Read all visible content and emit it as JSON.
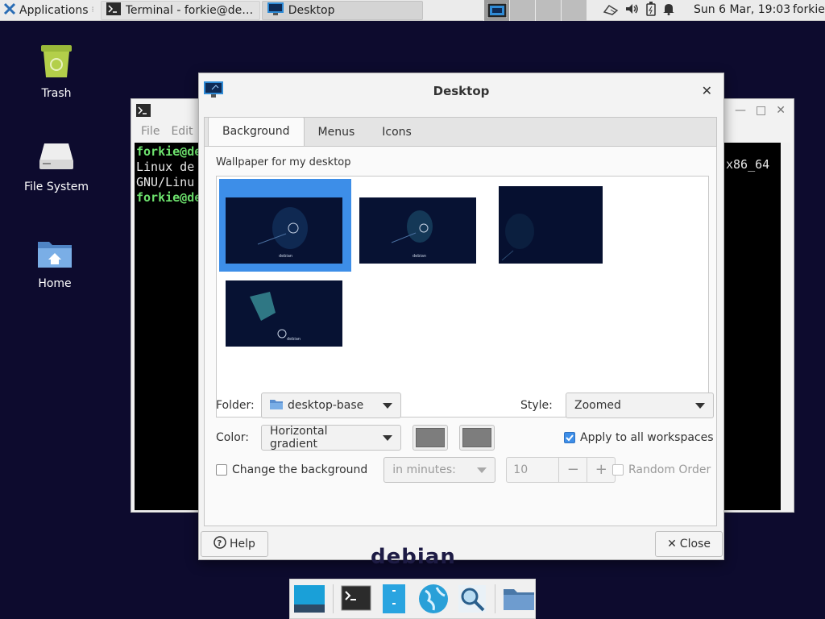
{
  "top_panel": {
    "applications_label": "Applications",
    "tasks": [
      {
        "title": "Terminal - forkie@debia...",
        "icon": "terminal-icon"
      },
      {
        "title": "Desktop",
        "icon": "desktop-settings-icon"
      }
    ],
    "clock": "Sun  6 Mar, 19:03",
    "user": "forkie",
    "tray_icons": [
      "network-icon",
      "volume-icon",
      "battery-icon",
      "notification-bell-icon"
    ]
  },
  "desktop_icons": [
    {
      "label": "Trash",
      "icon": "trash-icon"
    },
    {
      "label": "File System",
      "icon": "drive-icon"
    },
    {
      "label": "Home",
      "icon": "home-folder-icon"
    }
  ],
  "terminal": {
    "menu": [
      "File",
      "Edit"
    ],
    "lines": [
      "forkie@de",
      "Linux de",
      "GNU/Linu",
      "forkie@de"
    ],
    "right_fragment": "x86_64"
  },
  "dialog": {
    "title": "Desktop",
    "tabs": [
      "Background",
      "Menus",
      "Icons"
    ],
    "active_tab": "Background",
    "wallpaper_label": "Wallpaper for my desktop",
    "thumb_caption": "debian",
    "folder_label": "Folder:",
    "folder_value": "desktop-base",
    "style_label": "Style:",
    "style_value": "Zoomed",
    "color_label": "Color:",
    "color_value": "Horizontal gradient",
    "color1": "#7d7d7d",
    "color2": "#7d7d7d",
    "apply_all_label": "Apply to all workspaces",
    "apply_all_checked": true,
    "change_bg_label": "Change the background",
    "change_bg_checked": false,
    "interval_unit": "in minutes:",
    "interval_value": "10",
    "random_order_label": "Random Order",
    "help_label": "Help",
    "close_label": "Close"
  },
  "wordmark": "debian",
  "dock": [
    "show-desktop-icon",
    "terminal-icon",
    "file-manager-icon",
    "web-browser-icon",
    "search-icon",
    "folder-icon"
  ]
}
